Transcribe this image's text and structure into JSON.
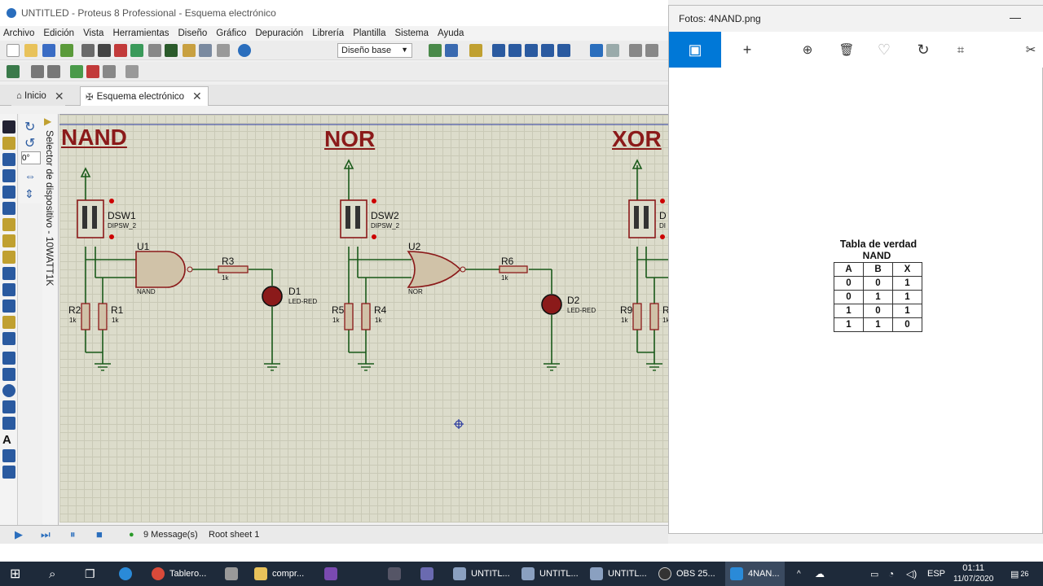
{
  "proteus": {
    "title": "UNTITLED - Proteus 8 Professional - Esquema electrónico",
    "menu": [
      "Archivo",
      "Edición",
      "Vista",
      "Herramientas",
      "Diseño",
      "Gráfico",
      "Depuración",
      "Librería",
      "Plantilla",
      "Sistema",
      "Ayuda"
    ],
    "layout_select": "Diseño base",
    "tabs": [
      {
        "label": "Inicio"
      },
      {
        "label": "Esquema electrónico"
      }
    ],
    "rotation_field": "0°",
    "selector_label": "Selector de dispositivo - 10WATT1K",
    "status": {
      "messages": "9 Message(s)",
      "sheet": "Root sheet 1"
    }
  },
  "schematic": {
    "titles": [
      "NAND",
      "NOR",
      "XOR"
    ],
    "nand": {
      "switch": "DSW1",
      "switch_type": "DIPSW_2",
      "gate": "U1",
      "gate_type": "NAND",
      "resistor_out": "R3",
      "resistor_out_value": "1k",
      "led": "D1",
      "led_type": "LED-RED",
      "r_left": "R2",
      "r_left_value": "1k",
      "r_right": "R1",
      "r_right_value": "1k"
    },
    "nor": {
      "switch": "DSW2",
      "switch_type": "DIPSW_2",
      "gate": "U2",
      "gate_type": "NOR",
      "resistor_out": "R6",
      "resistor_out_value": "1k",
      "led": "D2",
      "led_type": "LED-RED",
      "r_left": "R5",
      "r_left_value": "1k",
      "r_right": "R4",
      "r_right_value": "1k"
    },
    "xor": {
      "switch": "D",
      "switch_type": "DI",
      "r_left": "R9",
      "r_left_value": "1k",
      "r_right": "R",
      "r_right_value": "1k"
    }
  },
  "photos": {
    "title": "Fotos: 4NAND.png",
    "table_title": "Tabla de verdad",
    "table_subtitle": "NAND",
    "headers": [
      "A",
      "B",
      "X"
    ],
    "rows": [
      [
        "0",
        "0",
        "1"
      ],
      [
        "0",
        "1",
        "1"
      ],
      [
        "1",
        "0",
        "1"
      ],
      [
        "1",
        "1",
        "0"
      ]
    ]
  },
  "taskbar": {
    "items": [
      "Tablero...",
      "compr...",
      "UNTITL...",
      "UNTITL...",
      "UNTITL...",
      "OBS 25...",
      "4NAN..."
    ],
    "lang": "ESP",
    "time": "01:11",
    "date": "11/07/2020",
    "notif": "26"
  }
}
